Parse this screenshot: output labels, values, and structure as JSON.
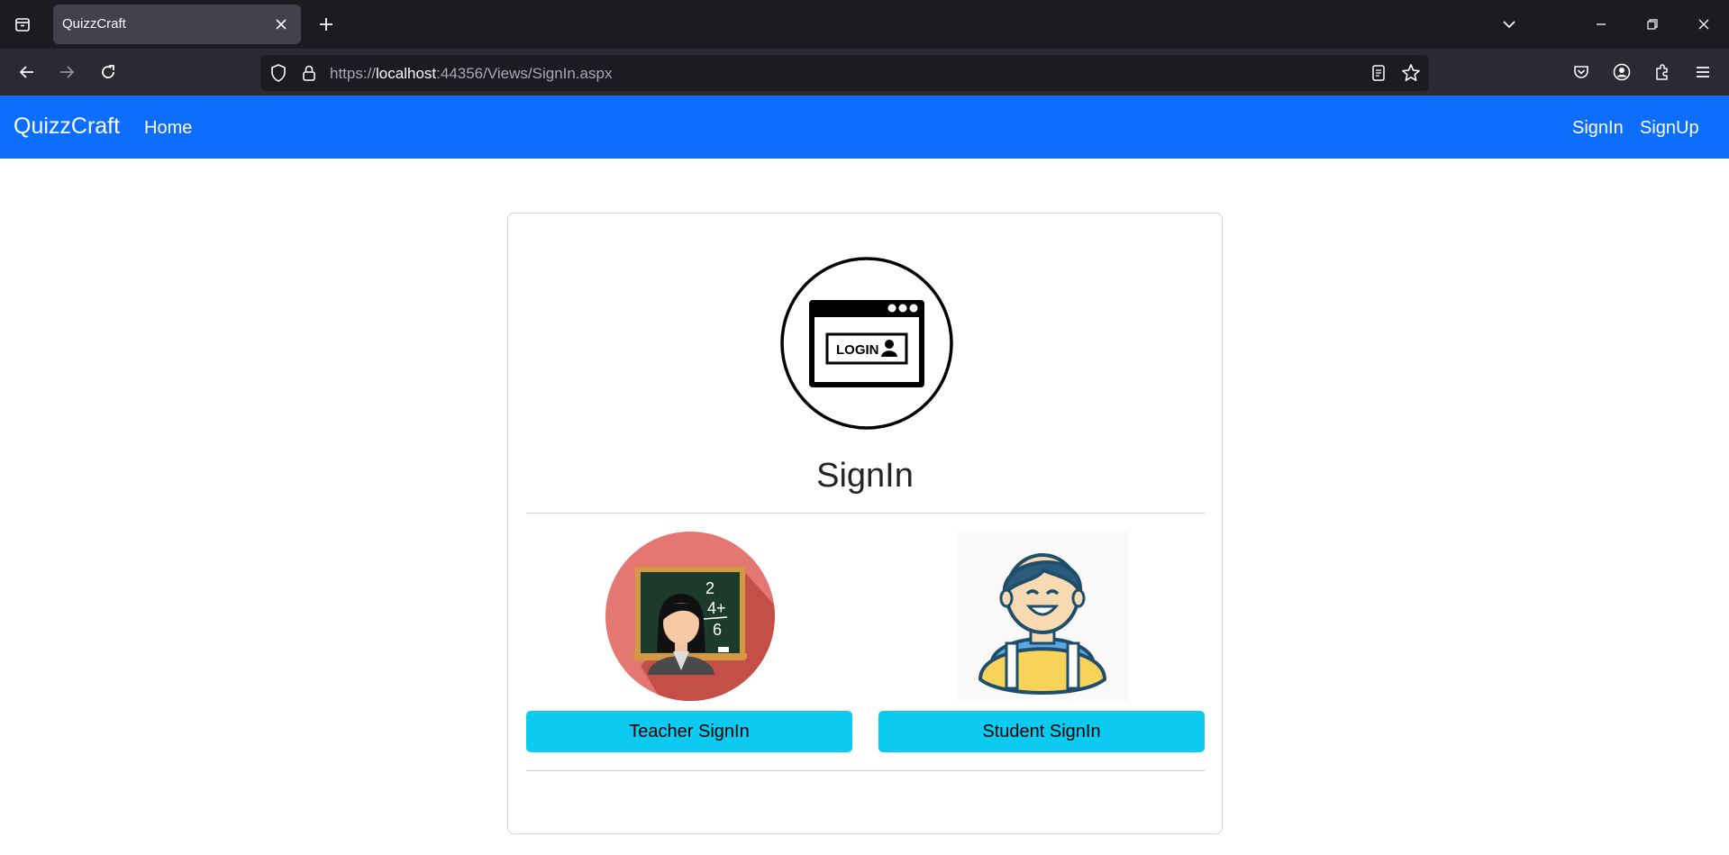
{
  "browser": {
    "tab_title": "QuizzCraft",
    "url_prefix": "https://",
    "url_host": "localhost",
    "url_rest": ":44356/Views/SignIn.aspx"
  },
  "site": {
    "brand": "QuizzCraft",
    "nav_home": "Home",
    "nav_signin": "SignIn",
    "nav_signup": "SignUp",
    "accent_color": "#0d6efd"
  },
  "card": {
    "login_badge_text": "LOGIN",
    "title": "SignIn",
    "teacher_button": "Teacher SignIn",
    "student_button": "Student SignIn",
    "teacher_board_text": [
      "2",
      "4+",
      "6"
    ],
    "button_color": "#0dcaf0"
  },
  "icons": [
    "tab-list-icon",
    "close-icon",
    "new-tab-icon",
    "back-icon",
    "forward-icon",
    "reload-icon",
    "shield-icon",
    "lock-icon",
    "reader-view-icon",
    "bookmark-star-icon",
    "pocket-icon",
    "account-icon",
    "extensions-icon",
    "menu-icon",
    "tabs-dropdown-icon",
    "minimize-icon",
    "restore-icon",
    "window-close-icon"
  ]
}
